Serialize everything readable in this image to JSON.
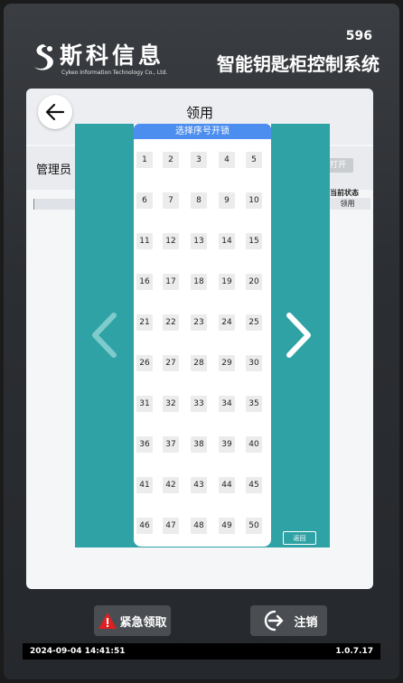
{
  "brand": {
    "name": "斯科信息",
    "subtitle": "Cykeo Information Technology Co., Ltd."
  },
  "header": {
    "device_number": "596",
    "system_title": "智能钥匙柜控制系统"
  },
  "panel": {
    "title": "领用",
    "field_label": "管理员",
    "open_button": "打开",
    "status_header": "当前状态",
    "status_value": "领用"
  },
  "picker": {
    "title": "选择序号开锁",
    "slots": [
      "1",
      "2",
      "3",
      "4",
      "5",
      "6",
      "7",
      "8",
      "9",
      "10",
      "11",
      "12",
      "13",
      "14",
      "15",
      "16",
      "17",
      "18",
      "19",
      "20",
      "21",
      "22",
      "23",
      "24",
      "25",
      "26",
      "27",
      "28",
      "29",
      "30",
      "31",
      "32",
      "33",
      "34",
      "35",
      "36",
      "37",
      "38",
      "39",
      "40",
      "41",
      "42",
      "43",
      "44",
      "45",
      "46",
      "47",
      "48",
      "49",
      "50"
    ],
    "return_label": "返回"
  },
  "actions": {
    "emergency_label": "紧急领取",
    "logout_label": "注销"
  },
  "footer": {
    "datetime": "2024-09-04 14:41:51",
    "version": "1.0.7.17"
  },
  "colors": {
    "overlay": "#2ea2a5",
    "picker_header": "#4b8ef0",
    "warning": "#e02020"
  },
  "icons": [
    "logo-icon",
    "back-arrow-icon",
    "chevron-left-icon",
    "chevron-right-icon",
    "warning-icon",
    "logout-icon"
  ]
}
